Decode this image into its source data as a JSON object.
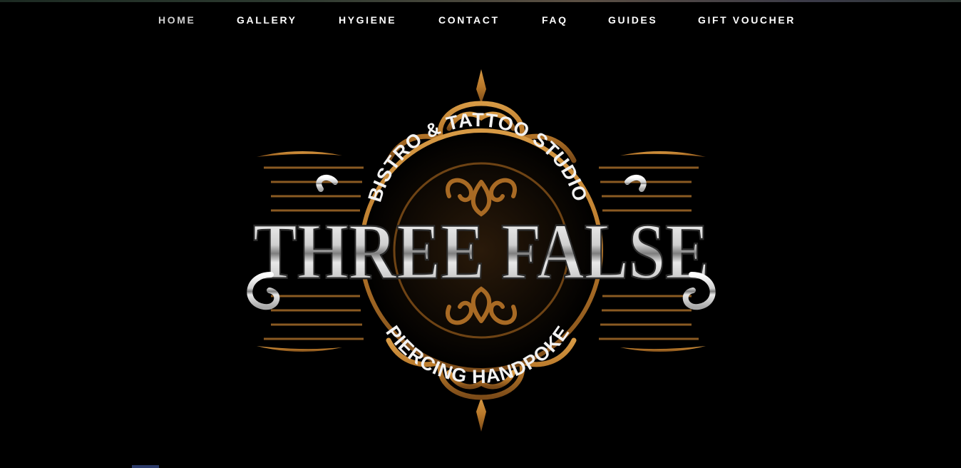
{
  "nav": {
    "items": [
      {
        "label": "HOME",
        "active": true
      },
      {
        "label": "GALLERY"
      },
      {
        "label": "HYGIENE"
      },
      {
        "label": "CONTACT"
      },
      {
        "label": "FAQ"
      },
      {
        "label": "GUIDES"
      },
      {
        "label": "GIFT VOUCHER"
      }
    ]
  },
  "logo": {
    "name": "THREE FALSE",
    "tagline_top": "BISTRO & TATTOO STUDIO",
    "tagline_bottom": "PIERCING HANDPOKE"
  },
  "colors": {
    "background": "#000000",
    "nav_text": "#ffffff",
    "ornament_gold": "#b8782a",
    "ornament_dark": "#6e4314",
    "logo_silver": "#e6e6e6"
  }
}
